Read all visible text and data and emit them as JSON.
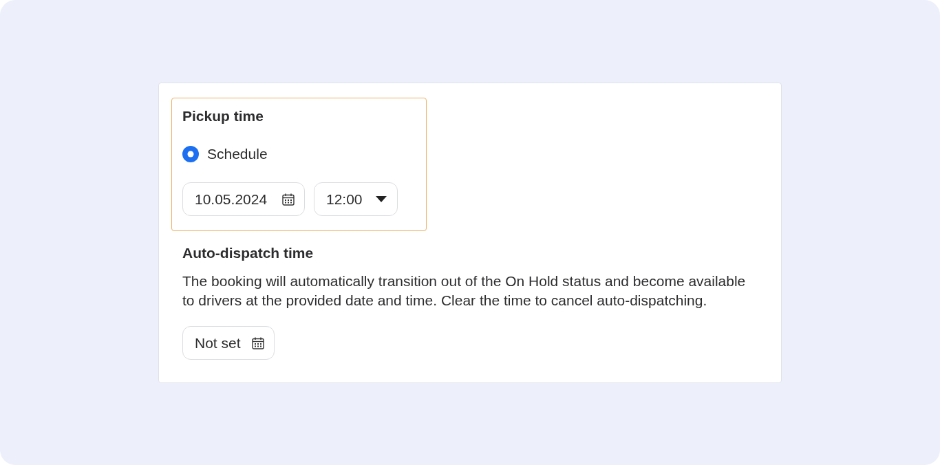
{
  "pickup": {
    "title": "Pickup time",
    "highlighted": true,
    "options": [
      {
        "label": "Schedule",
        "selected": true
      }
    ],
    "date_field": {
      "value": "10.05.2024"
    },
    "time_select": {
      "value": "12:00"
    }
  },
  "auto_dispatch": {
    "title": "Auto-dispatch time",
    "description": "The booking will automatically transition out of the On Hold status and become available to drivers at the provided date and time. Clear the time to cancel auto-dispatching.",
    "date_field": {
      "placeholder": "Not set"
    }
  }
}
